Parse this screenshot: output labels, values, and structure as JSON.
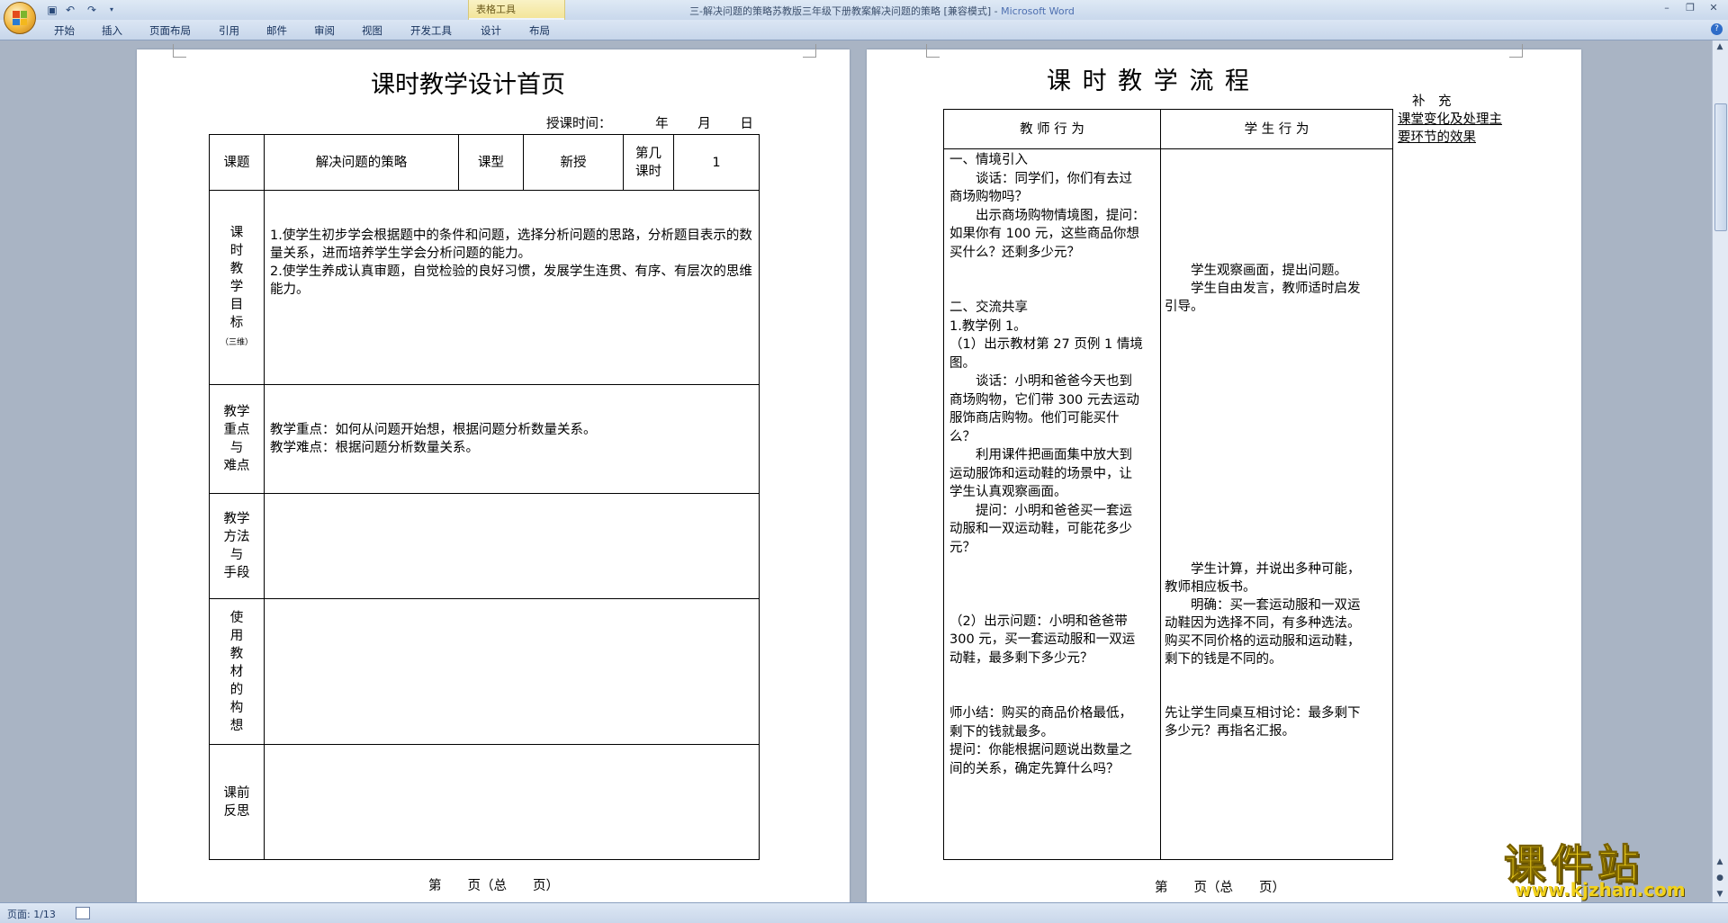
{
  "window": {
    "title_doc": "三-解决问题的策略苏教版三年级下册教案解决问题的策略 [兼容模式] - ",
    "title_app": "Microsoft Word",
    "contextual_group": "表格工具"
  },
  "quick_access": {
    "save_icon": "save-icon",
    "undo_icon": "undo-icon",
    "redo_icon": "redo-icon",
    "customize_icon": "customize-qat-icon"
  },
  "ribbon": {
    "tabs": [
      "开始",
      "插入",
      "页面布局",
      "引用",
      "邮件",
      "审阅",
      "视图",
      "开发工具",
      "设计",
      "布局"
    ]
  },
  "left_page": {
    "title": "课时教学设计首页",
    "date_label": "授课时间：",
    "date_year": "年",
    "date_month": "月",
    "date_day": "日",
    "row1": {
      "topic_label": "课题",
      "topic_value": "解决问题的策略",
      "type_label": "课型",
      "type_value": "新授",
      "lesson_no_label_1": "第几",
      "lesson_no_label_2": "课时",
      "lesson_no_value": "1"
    },
    "goals_label": [
      "课",
      "时",
      "教",
      "学",
      "目",
      "标"
    ],
    "goals_sub": "（三维）",
    "goals_text": [
      "1.使学生初步学会根据题中的条件和问题，选择分析问题的思路，分析题目表示的数量关系，进而培养学生学会分析问题的能力。",
      "2.使学生养成认真审题，自觉检验的良好习惯，发展学生连贯、有序、有层次的思维能力。"
    ],
    "key_label": [
      "教学",
      "重点",
      "与",
      "难点"
    ],
    "key_text": [
      "教学重点：如何从问题开始想，根据问题分析数量关系。",
      "教学难点：根据问题分析数量关系。"
    ],
    "method_label": [
      "教学",
      "方法",
      "与",
      "手段"
    ],
    "material_label": [
      "使",
      "用",
      "教",
      "材",
      "的",
      "构",
      "想"
    ],
    "reflect_label": [
      "课前",
      "反思"
    ],
    "footer": "第　　页（总　　页）"
  },
  "right_page": {
    "title": "课 时 教 学 流 程",
    "supplement_title": "补　充",
    "col_teacher": "教 师 行 为",
    "col_student": "学 生 行 为",
    "col_note": "课堂变化及处理主要环节的效果",
    "teacher_lines": [
      "一、情境引入",
      "　　谈话：同学们，你们有去过",
      "商场购物吗？",
      "　　出示商场购物情境图，提问：",
      "如果你有 100 元，这些商品你想",
      "买什么？还剩多少元？",
      "",
      "",
      "二、交流共享",
      "1.教学例 1。",
      "（1）出示教材第 27 页例 1 情境",
      "图。",
      "　　谈话：小明和爸爸今天也到",
      "商场购物，它们带 300 元去运动",
      "服饰商店购物。他们可能买什",
      "么？",
      "　　利用课件把画面集中放大到",
      "运动服饰和运动鞋的场景中，让",
      "学生认真观察画面。",
      "　　提问：小明和爸爸买一套运",
      "动服和一双运动鞋，可能花多少",
      "元？",
      "",
      "",
      "",
      "（2）出示问题：小明和爸爸带",
      "300 元，买一套运动服和一双运",
      "动鞋，最多剩下多少元？",
      "",
      "",
      "师小结：购买的商品价格最低，",
      "剩下的钱就最多。",
      "提问：你能根据问题说出数量之",
      "间的关系，确定先算什么吗？"
    ],
    "student_lines": [
      "　　学生观察画面，提出问题。",
      "　　学生自由发言，教师适时启发",
      "引导。",
      "　　学生计算，并说出多种可能，",
      "教师相应板书。",
      "　　明确：买一套运动服和一双运",
      "动鞋因为选择不同，有多种选法。",
      "购买不同价格的运动服和运动鞋，",
      "剩下的钱是不同的。",
      "先让学生同桌互相讨论：最多剩下",
      "多少元？再指名汇报。"
    ],
    "footer": "第　　页（总　　页）"
  },
  "status": {
    "page_count": "页面: 1/13"
  },
  "watermark": {
    "brand": "课件站",
    "url": "www.kjzhan.com"
  },
  "marks": {
    "paragraph": "↵"
  }
}
